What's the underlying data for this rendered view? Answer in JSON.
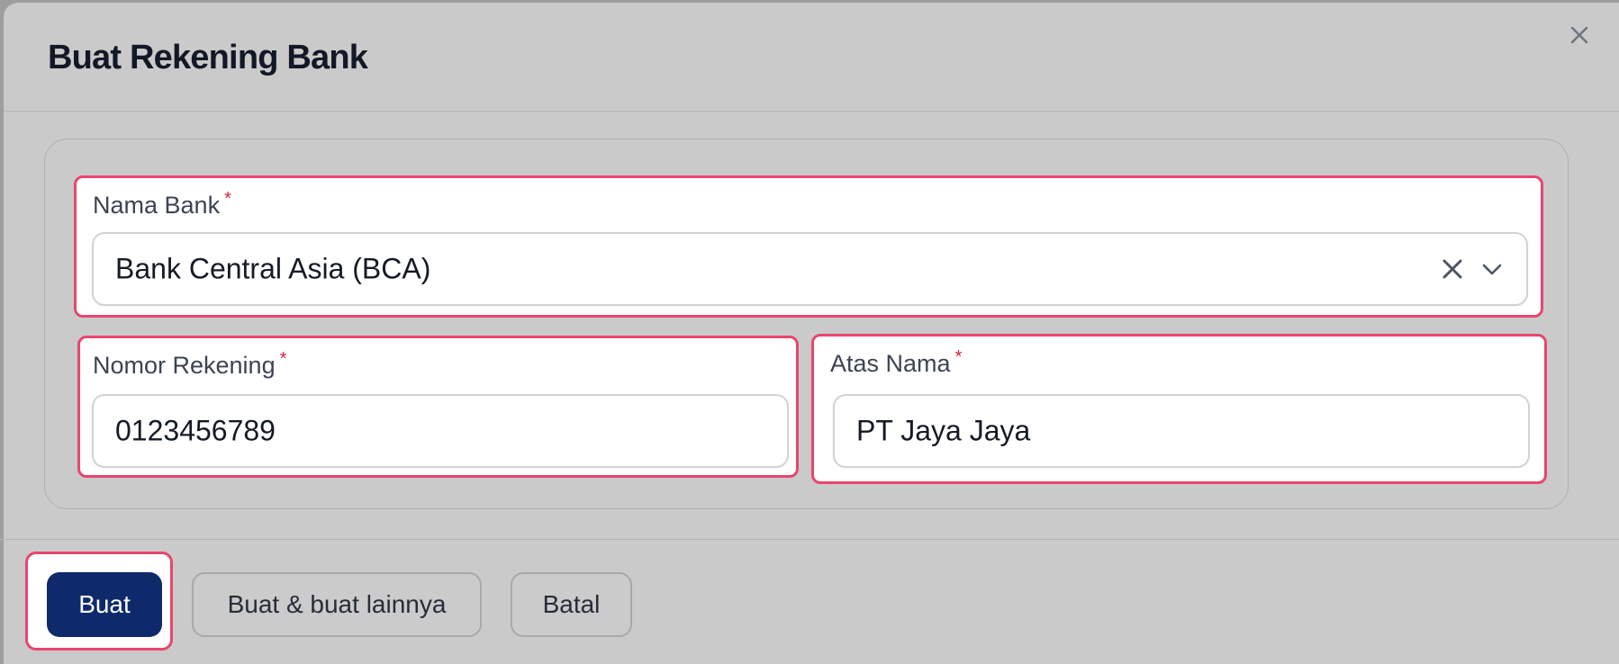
{
  "modal": {
    "title": "Buat Rekening Bank"
  },
  "form": {
    "bank": {
      "label": "Nama Bank",
      "required_mark": "*",
      "value": "Bank Central Asia (BCA)"
    },
    "account_number": {
      "label": "Nomor Rekening",
      "required_mark": "*",
      "value": "0123456789"
    },
    "account_name": {
      "label": "Atas Nama",
      "required_mark": "*",
      "value": "PT Jaya Jaya"
    }
  },
  "footer": {
    "create_label": "Buat",
    "create_another_label": "Buat & buat lainnya",
    "cancel_label": "Batal"
  },
  "icons": {
    "close": "close-icon",
    "clear": "clear-icon",
    "chevron": "chevron-down-icon"
  },
  "colors": {
    "primary": "#0f2a6b",
    "highlight": "#e8466f",
    "required": "#d2233f"
  }
}
